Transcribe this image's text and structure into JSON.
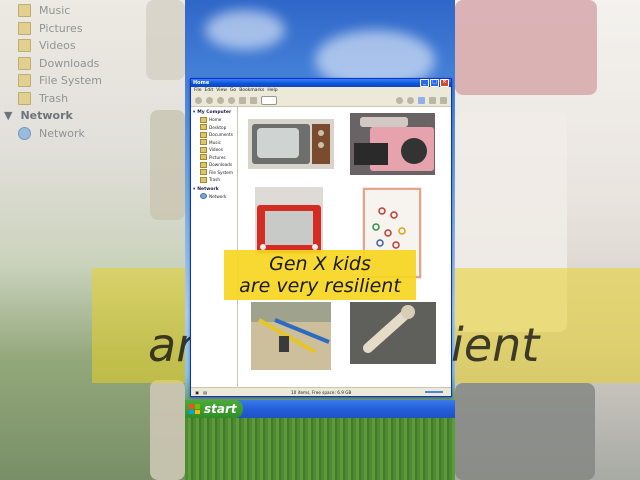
{
  "window": {
    "title": "Home",
    "menu": [
      "File",
      "Edit",
      "View",
      "Go",
      "Bookmarks",
      "Help"
    ],
    "sidebar": {
      "my_computer": "My Computer",
      "items": [
        "Home",
        "Desktop",
        "Documents",
        "Music",
        "Videos",
        "Pictures",
        "Downloads",
        "File System",
        "Trash"
      ],
      "network_header": "Network",
      "network_items": [
        "Network"
      ]
    },
    "status": "10 items, Free space: 6.9 GB"
  },
  "background_sidebar": {
    "items": [
      "Music",
      "Pictures",
      "Videos",
      "Downloads",
      "File System",
      "Trash"
    ],
    "network_header": "Network",
    "network_items": [
      "Network"
    ]
  },
  "caption": {
    "line1": "Gen X kids",
    "line2": "are very resilient"
  },
  "background_caption": "are very resilient",
  "taskbar": {
    "start_label": "start"
  },
  "thumbnails": [
    {
      "name": "tv-icon",
      "caption": ""
    },
    {
      "name": "boombox-icon",
      "caption": ""
    },
    {
      "name": "etch-a-sketch-icon",
      "caption": ""
    },
    {
      "name": "lite-brite-icon",
      "caption": ""
    },
    {
      "name": "seesaw-icon",
      "caption": ""
    },
    {
      "name": "phone-icon",
      "caption": ""
    }
  ]
}
